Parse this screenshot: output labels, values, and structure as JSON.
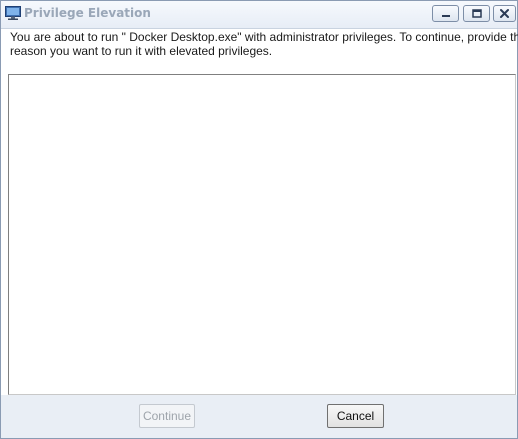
{
  "window": {
    "title": "Privilege Elevation",
    "app_icon": "monitor-icon"
  },
  "title_buttons": {
    "minimize_icon": "minimize-icon",
    "maximize_icon": "maximize-icon",
    "close_icon": "close-icon"
  },
  "message": {
    "line1": "You are about to run \" Docker Desktop.exe\" with administrator privileges. To continue, provide the",
    "line2": "reason you want to run it with elevated privileges."
  },
  "reason_input": {
    "value": "",
    "placeholder": ""
  },
  "buttons": {
    "continue_label": "Continue",
    "continue_enabled": false,
    "cancel_label": "Cancel"
  },
  "colors": {
    "title_text": "#9aa7b8",
    "window_border": "#8a9bb3",
    "footer_bg": "#e9eef5"
  }
}
